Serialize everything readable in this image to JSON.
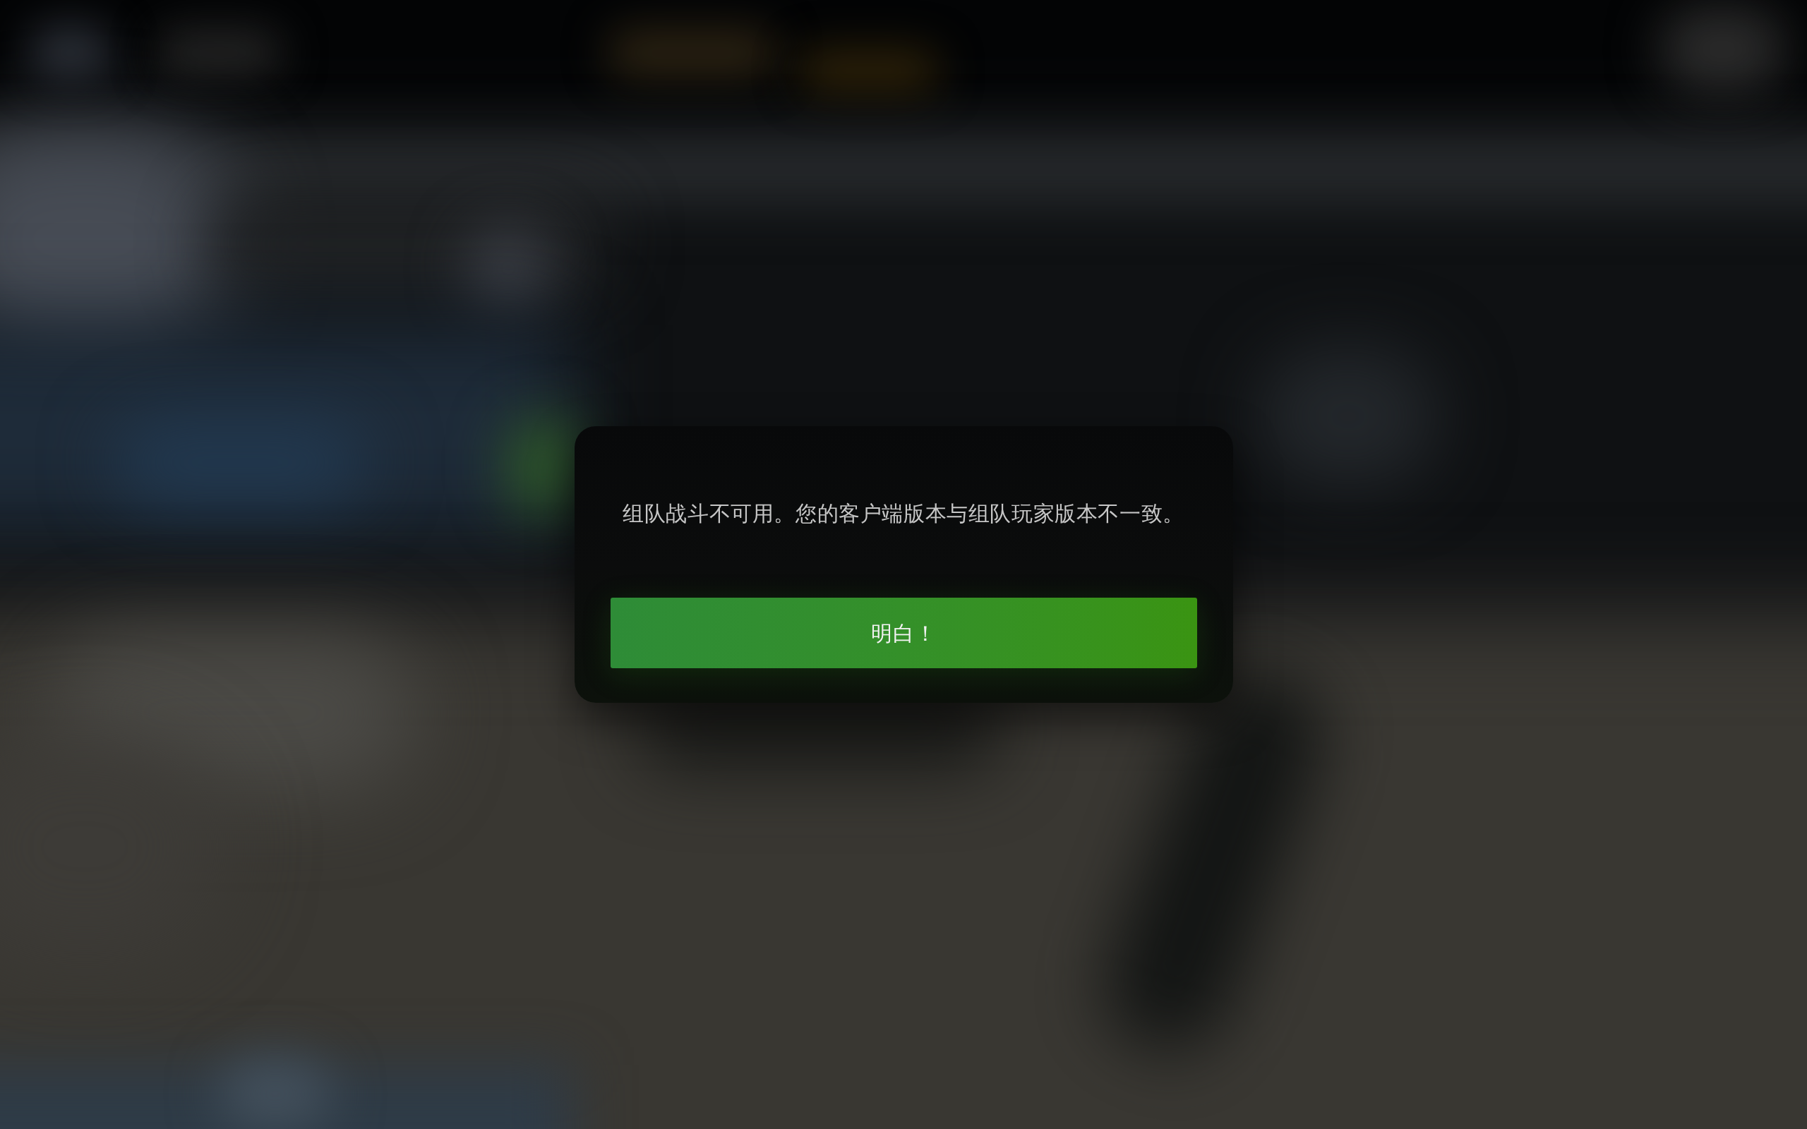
{
  "dialog": {
    "message": "组队战斗不可用。您的客户端版本与组队玩家版本不一致。",
    "button": {
      "label": "明白！"
    }
  }
}
